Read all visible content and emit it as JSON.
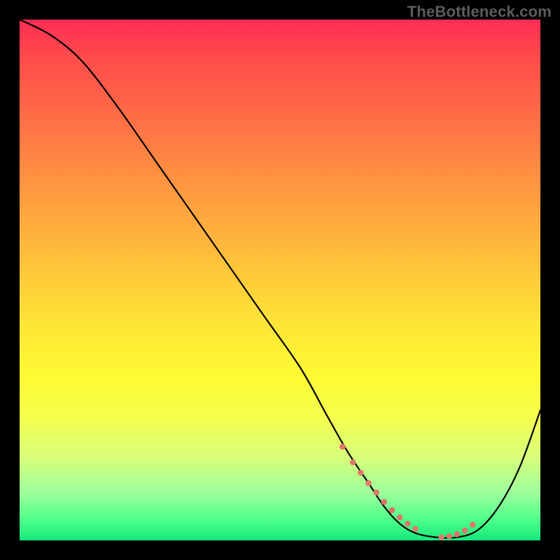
{
  "watermark": "TheBottleneck.com",
  "colors": {
    "background": "#000000",
    "curve": "#000000",
    "dot": "#e0776a"
  },
  "chart_data": {
    "type": "line",
    "title": "",
    "xlabel": "",
    "ylabel": "",
    "xlim": [
      0,
      100
    ],
    "ylim": [
      0,
      100
    ],
    "x": [
      0,
      6,
      12,
      19,
      26,
      33,
      40,
      47,
      54,
      59,
      63,
      67,
      70,
      73,
      76,
      80,
      84,
      88,
      92,
      96,
      100
    ],
    "values": [
      100,
      97,
      92,
      83,
      73,
      63,
      53,
      43,
      33,
      24,
      17,
      11,
      6.5,
      3.2,
      1.4,
      0.6,
      0.6,
      2.0,
      6.5,
      14,
      25
    ],
    "annotations": {
      "valley_dot_x": [
        62,
        64,
        65.5,
        67,
        68.5,
        70,
        71.5,
        73,
        74.5,
        76,
        81,
        82.5,
        84,
        85.5,
        87
      ],
      "valley_dot_y": [
        18,
        15,
        13,
        11,
        9.2,
        7.4,
        5.8,
        4.4,
        3.2,
        2.2,
        0.6,
        0.8,
        1.2,
        1.9,
        3.0
      ]
    }
  }
}
